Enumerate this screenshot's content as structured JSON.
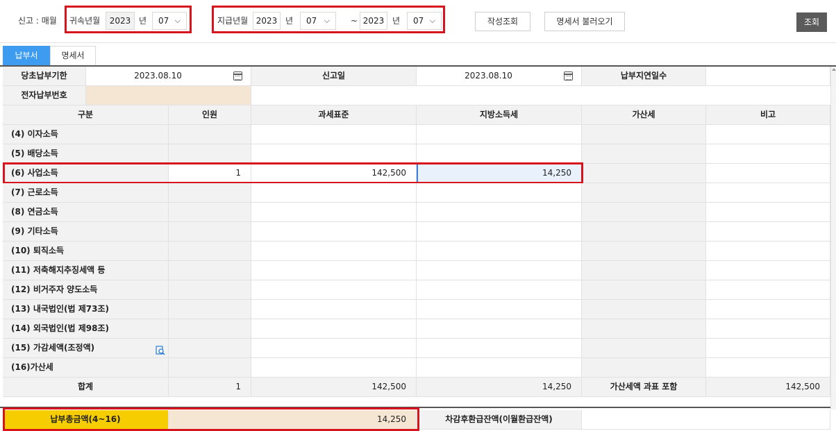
{
  "filter": {
    "report_type": "신고 : 매월",
    "attribution_label": "귀속년월",
    "attribution_year": "2023",
    "year_unit": "년",
    "attribution_month": "07",
    "payment_label": "지급년월",
    "payment_start_year": "2023",
    "payment_start_month": "07",
    "range_sep": "~",
    "payment_end_year": "2023",
    "payment_end_month": "07",
    "btn_write_lookup": "작성조회",
    "btn_load_statement": "명세서 불러오기",
    "btn_search": "조회"
  },
  "tabs": {
    "payment": "납부서",
    "statement": "명세서"
  },
  "info": {
    "due_label": "당초납부기한",
    "due_value": "2023.08.10",
    "report_date_label": "신고일",
    "report_date_value": "2023.08.10",
    "delay_days_label": "납부지연일수",
    "delay_days_value": "",
    "epay_label": "전자납부번호",
    "epay_value": ""
  },
  "columns": [
    "구분",
    "인원",
    "과세표준",
    "지방소득세",
    "가산세",
    "비고"
  ],
  "rows": [
    {
      "label": "(4) 이자소득",
      "people": "",
      "base": "",
      "tax": ""
    },
    {
      "label": "(5) 배당소득",
      "people": "",
      "base": "",
      "tax": ""
    },
    {
      "label": "(6) 사업소득",
      "people": "1",
      "base": "142,500",
      "tax": "14,250"
    },
    {
      "label": "(7) 근로소득",
      "people": "",
      "base": "",
      "tax": ""
    },
    {
      "label": "(8) 연금소득",
      "people": "",
      "base": "",
      "tax": ""
    },
    {
      "label": "(9) 기타소득",
      "people": "",
      "base": "",
      "tax": ""
    },
    {
      "label": "(10) 퇴직소득",
      "people": "",
      "base": "",
      "tax": ""
    },
    {
      "label": "(11) 저축해지추징세액 등",
      "people": "",
      "base": "",
      "tax": ""
    },
    {
      "label": "(12) 비거주자 양도소득",
      "people": "",
      "base": "",
      "tax": ""
    },
    {
      "label": "(13) 내국법인(법 제73조)",
      "people": "",
      "base": "",
      "tax": ""
    },
    {
      "label": "(14) 외국법인(법 제98조)",
      "people": "",
      "base": "",
      "tax": ""
    },
    {
      "label": "(15) 가감세액(조정액)",
      "people": "",
      "base": "",
      "tax": ""
    },
    {
      "label": "(16)가산세",
      "people": "",
      "base": "",
      "tax": ""
    }
  ],
  "total": {
    "label": "합계",
    "people": "1",
    "base": "142,500",
    "tax": "14,250",
    "penalty_incl_label": "가산세액 과표 포함",
    "penalty_incl_value": "142,500"
  },
  "summary": {
    "total_payment_label": "납부총금액(4~16)",
    "total_payment_value": "14,250",
    "refund_label": "차감후환급잔액(이월환급잔액)",
    "refund_value": ""
  }
}
